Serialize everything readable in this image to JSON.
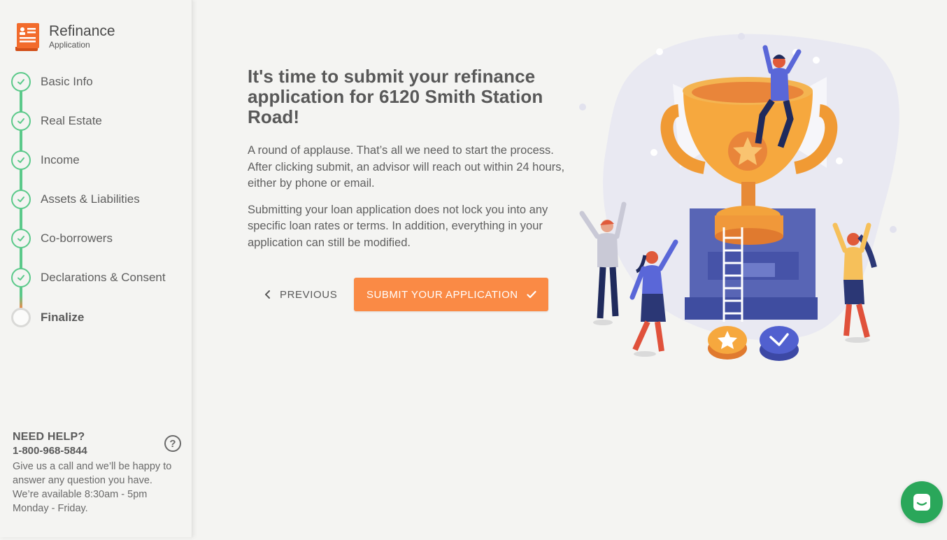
{
  "brand": {
    "title": "Refinance",
    "subtitle": "Application",
    "icon": "document-icon",
    "color": "#f26b2c"
  },
  "steps": [
    {
      "label": "Basic Info",
      "status": "complete"
    },
    {
      "label": "Real Estate",
      "status": "complete"
    },
    {
      "label": "Income",
      "status": "complete"
    },
    {
      "label": "Assets & Liabilities",
      "status": "complete"
    },
    {
      "label": "Co-borrowers",
      "status": "complete"
    },
    {
      "label": "Declarations & Consent",
      "status": "complete"
    },
    {
      "label": "Finalize",
      "status": "current"
    }
  ],
  "help": {
    "title": "NEED HELP?",
    "phone": "1-800-968-5844",
    "text": "Give us a call and we’ll be happy to answer any question you have. We’re available 8:30am - 5pm Monday - Friday.",
    "icon": "question-icon"
  },
  "main": {
    "headline": "It's time to submit your refinance application for 6120 Smith Station Road!",
    "paragraph1": "A round of applause. That’s all we need to start the process. After clicking submit, an advisor will reach out within 24 hours, either by phone or email.",
    "paragraph2": "Submitting your loan application does not lock you into any specific loan rates or terms. In addition, everything in your application can still be modified."
  },
  "actions": {
    "previous_label": "PREVIOUS",
    "submit_label": "SUBMIT YOUR APPLICATION"
  },
  "colors": {
    "accent": "#fa8a45",
    "complete": "#5bc98a",
    "chat": "#2aa75a"
  },
  "chat": {
    "icon": "chat-icon"
  }
}
